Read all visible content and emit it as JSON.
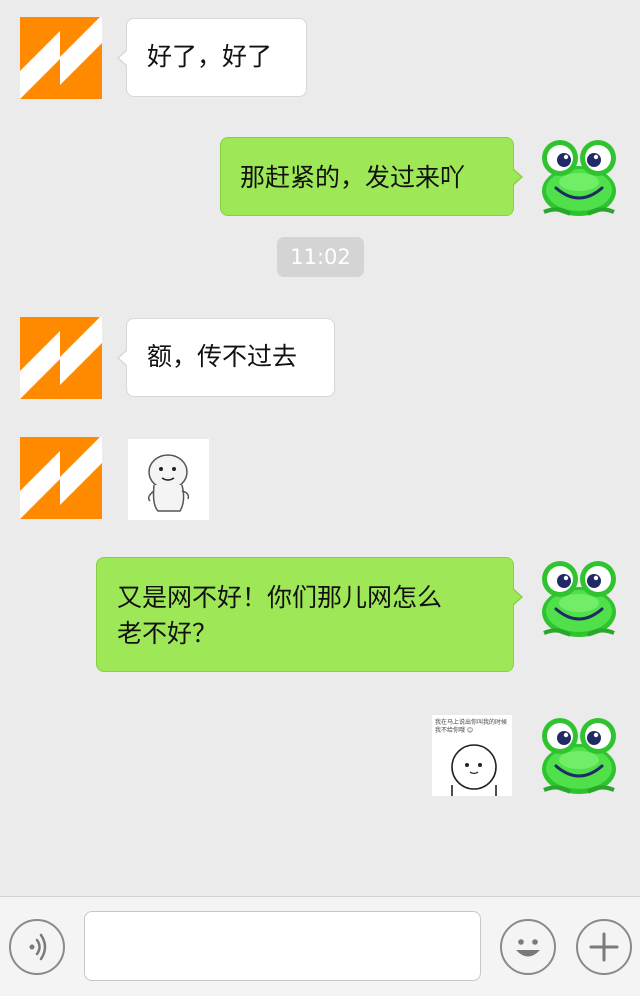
{
  "messages": [
    {
      "side": "left",
      "type": "text",
      "text": "好了，好了"
    },
    {
      "side": "right",
      "type": "text",
      "text": "那赶紧的，发过来吖"
    },
    {
      "type": "time",
      "text": "11:02"
    },
    {
      "side": "left",
      "type": "text",
      "text": "额，传不过去"
    },
    {
      "side": "left",
      "type": "sticker"
    },
    {
      "side": "right",
      "type": "text",
      "line1": "又是网不好！你们那儿网怎么",
      "line2": "老不好？"
    },
    {
      "side": "right",
      "type": "sticker",
      "caption": "我在马上说出你叫我的时候我不给你哦 😊"
    }
  ],
  "input_bar": {
    "voice_icon": "voice-wave-icon",
    "emoji_icon": "smiley-face-icon",
    "more_icon": "plus-icon",
    "text_value": ""
  },
  "colors": {
    "background": "#ebebeb",
    "bubble_green": "#9ee857",
    "bubble_white": "#ffffff",
    "avatar_orange": "#ff8a00",
    "frog_green": "#3fd43a"
  }
}
